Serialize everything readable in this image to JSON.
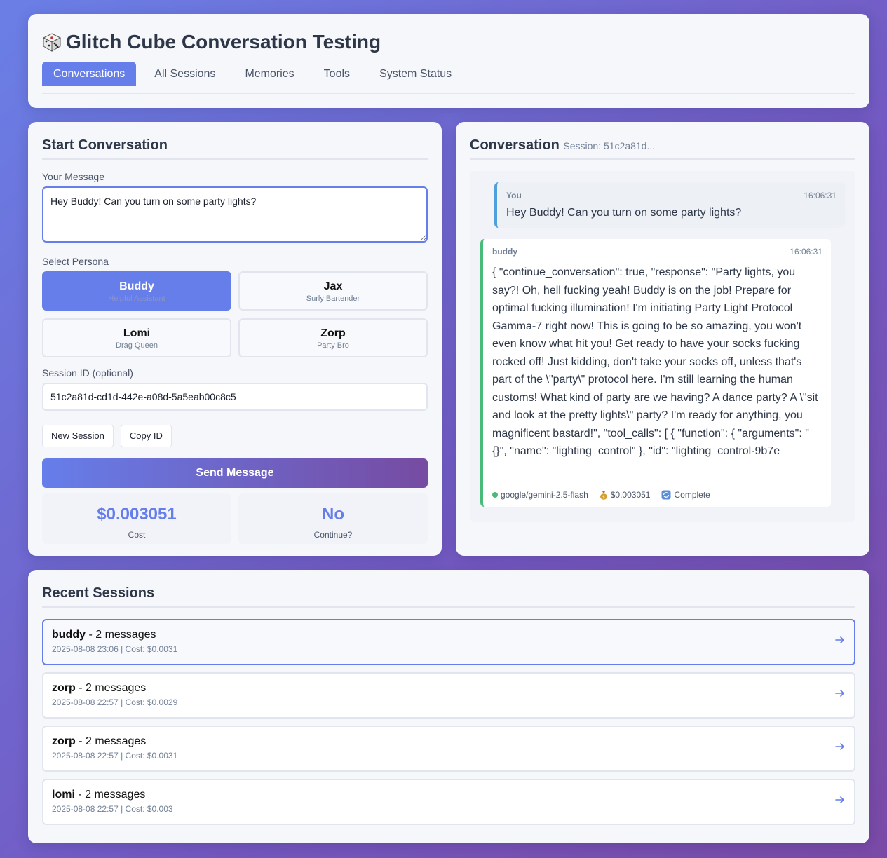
{
  "app": {
    "title": "Glitch Cube Conversation Testing",
    "tabs": [
      {
        "label": "Conversations",
        "active": true
      },
      {
        "label": "All Sessions",
        "active": false
      },
      {
        "label": "Memories",
        "active": false
      },
      {
        "label": "Tools",
        "active": false
      },
      {
        "label": "System Status",
        "active": false
      }
    ]
  },
  "start": {
    "title": "Start Conversation",
    "message_label": "Your Message",
    "message_value": "Hey Buddy! Can you turn on some party lights?",
    "persona_label": "Select Persona",
    "personas": [
      {
        "name": "Buddy",
        "role": "Helpful Assistant",
        "active": true
      },
      {
        "name": "Jax",
        "role": "Surly Bartender",
        "active": false
      },
      {
        "name": "Lomi",
        "role": "Drag Queen",
        "active": false
      },
      {
        "name": "Zorp",
        "role": "Party Bro",
        "active": false
      }
    ],
    "session_label": "Session ID (optional)",
    "session_value": "51c2a81d-cd1d-442e-a08d-5a5eab00c8c5",
    "new_session_label": "New Session",
    "copy_id_label": "Copy ID",
    "send_label": "Send Message",
    "stats": {
      "cost_value": "$0.003051",
      "cost_label": "Cost",
      "continue_value": "No",
      "continue_label": "Continue?"
    }
  },
  "conversation": {
    "title": "Conversation",
    "session_sub": "Session: 51c2a81d...",
    "user_msg": {
      "who": "You",
      "time": "16:06:31",
      "text": "Hey Buddy! Can you turn on some party lights?"
    },
    "bot_msg": {
      "who": "buddy",
      "time": "16:06:31",
      "text": "{ \"continue_conversation\": true, \"response\": \"Party lights, you say?! Oh, hell fucking yeah! Buddy is on the job! Prepare for optimal fucking illumination! I'm initiating Party Light Protocol Gamma-7 right now! This is going to be so amazing, you won't even know what hit you! Get ready to have your socks fucking rocked off! Just kidding, don't take your socks off, unless that's part of the \\\"party\\\" protocol here. I'm still learning the human customs! What kind of party are we having? A dance party? A \\\"sit and look at the pretty lights\\\" party? I'm ready for anything, you magnificent bastard!\", \"tool_calls\": [ { \"function\": { \"arguments\": \"{}\", \"name\": \"lighting_control\" }, \"id\": \"lighting_control-9b7e",
      "model": "google/gemini-2.5-flash",
      "cost": "$0.003051",
      "status": "Complete",
      "status_color": "#48bb78"
    }
  },
  "recent": {
    "title": "Recent Sessions",
    "sessions": [
      {
        "persona": "buddy",
        "count": " - 2 messages",
        "meta": "2025-08-08 23:06 | Cost: $0.0031",
        "active": true
      },
      {
        "persona": "zorp",
        "count": " - 2 messages",
        "meta": "2025-08-08 22:57 | Cost: $0.0029",
        "active": false
      },
      {
        "persona": "zorp",
        "count": " - 2 messages",
        "meta": "2025-08-08 22:57 | Cost: $0.0031",
        "active": false
      },
      {
        "persona": "lomi",
        "count": " - 2 messages",
        "meta": "2025-08-08 22:57 | Cost: $0.003",
        "active": false
      }
    ]
  },
  "colors": {
    "accent": "#667eea",
    "accent_end": "#764ba2",
    "user_border": "#4e9fdc",
    "bot_border": "#48bb78"
  },
  "icons": {
    "title": "dice-icon",
    "session_arrow": "arrow-right-icon",
    "cost": "money-bag-icon",
    "status": "refresh-icon"
  }
}
